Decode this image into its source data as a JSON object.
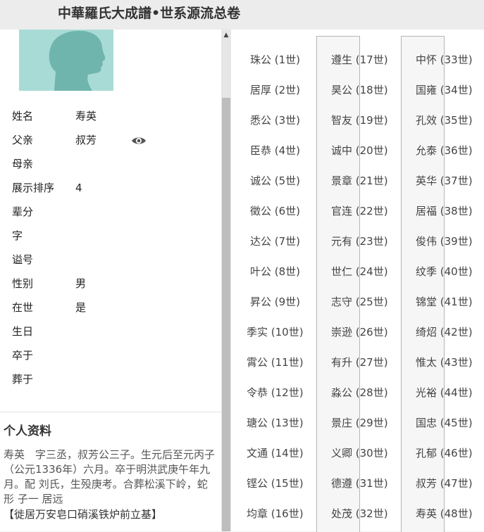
{
  "header": {
    "title": "中華羅氏大成譜•世系源流总卷"
  },
  "profile": {
    "fields": [
      {
        "label": "姓名",
        "value": "寿英"
      },
      {
        "label": "父亲",
        "value": "叔芳"
      },
      {
        "label": "母亲",
        "value": ""
      },
      {
        "label": "展示排序",
        "value": "4"
      },
      {
        "label": "辈分",
        "value": ""
      },
      {
        "label": "字",
        "value": ""
      },
      {
        "label": "谥号",
        "value": ""
      },
      {
        "label": "性别",
        "value": "男"
      },
      {
        "label": "在世",
        "value": "是"
      },
      {
        "label": "生日",
        "value": ""
      },
      {
        "label": "卒于",
        "value": ""
      },
      {
        "label": "葬于",
        "value": ""
      }
    ],
    "eye_icon": "eye-icon"
  },
  "bio": {
    "title": "个人资料",
    "text": "寿英　字三丞，叔芳公三子。生元后至元丙子（公元1336年）六月。卒于明洪武庚午年九月。配 刘氏，生殁庚考。合葬松溪下岭，蛇形 子一 居远",
    "note": "【徙居万安皂口硝溪铁炉前立基】"
  },
  "generations": [
    [
      "珠公 (1世)",
      "居厚 (2世)",
      "悉公 (3世)",
      "臣恭 (4世)",
      "诚公 (5世)",
      "徵公 (6世)",
      "达公 (7世)",
      "叶公 (8世)",
      "昇公 (9世)",
      "季实 (10世)",
      "霄公 (11世)",
      "令恭 (12世)",
      "瑭公 (13世)",
      "文通 (14世)",
      "铿公 (15世)",
      "均章 (16世)"
    ],
    [
      "遵生 (17世)",
      "昊公 (18世)",
      "智友 (19世)",
      "诚中 (20世)",
      "景章 (21世)",
      "官连 (22世)",
      "元有 (23世)",
      "世仁 (24世)",
      "志守 (25世)",
      "崇逊 (26世)",
      "有升 (27世)",
      "淼公 (28世)",
      "景庄 (29世)",
      "义卿 (30世)",
      "德遵 (31世)",
      "处茂 (32世)"
    ],
    [
      "中怀 (33世)",
      "国雍 (34世)",
      "孔效 (35世)",
      "允泰 (36世)",
      "英华 (37世)",
      "居福 (38世)",
      "俊伟 (39世)",
      "纹季 (40世)",
      "锦堂 (41世)",
      "绮炤 (42世)",
      "惟太 (43世)",
      "光裕 (44世)",
      "国忠 (45世)",
      "孔郁 (46世)",
      "叔芳 (47世)",
      "寿英 (48世)"
    ]
  ],
  "colors": {
    "avatar_bg": "#a9dbd6",
    "avatar_fg": "#6fb5ad"
  }
}
